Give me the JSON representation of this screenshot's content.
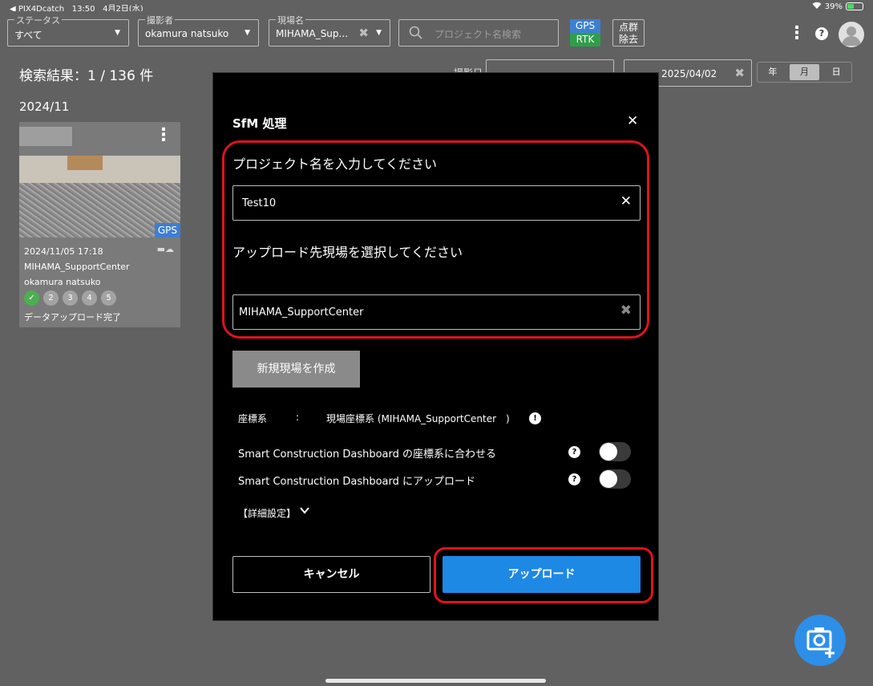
{
  "status_bar": {
    "back_app": "◀ PIX4Dcatch",
    "time": "13:50",
    "date": "4月2日(水)",
    "battery": "39%"
  },
  "filters": {
    "status": {
      "legend": "ステータス",
      "value": "すべて"
    },
    "photographer": {
      "legend": "撮影者",
      "value": "okamura natsuko"
    },
    "site": {
      "legend": "現場名",
      "value": "MIHAMA_Sup..."
    },
    "search_placeholder": "プロジェクト名検索",
    "gps_badge": {
      "top": "GPS",
      "bottom": "RTK"
    },
    "pointcloud_button": {
      "line1": "点群",
      "line2": "除去"
    }
  },
  "results": {
    "label": "検索結果：",
    "count": "1 / 136 件",
    "date_label": "撮影日",
    "date_to": "2025/04/02",
    "segment": [
      "年",
      "月",
      "日"
    ],
    "segment_selected": "月",
    "month_group": "2024/11"
  },
  "card": {
    "gps_tag": "GPS",
    "datetime": "2024/11/05  17:18",
    "site": "MIHAMA_SupportCenter",
    "photographer": "okamura natsuko",
    "steps": [
      "✓",
      "2",
      "3",
      "4",
      "5"
    ],
    "status": "データアップロード完了"
  },
  "modal": {
    "title": "SfM 処理",
    "project_label": "プロジェクト名を入力してください",
    "project_value": "Test10",
    "site_label": "アップロード先現場を選択してください",
    "site_value": "MIHAMA_SupportCenter",
    "new_site_button": "新規現場を作成",
    "coord_label": "座標系",
    "coord_colon": ":",
    "coord_value": "現場座標系 (MIHAMA_SupportCenter　)",
    "toggle1_label": "Smart Construction Dashboard の座標系に合わせる",
    "toggle2_label": "Smart Construction Dashboard にアップロード",
    "advanced_label": "【詳細設定】",
    "cancel_button": "キャンセル",
    "upload_button": "アップロード"
  },
  "colors": {
    "highlight": "#e0121a",
    "primary": "#1e88e5",
    "background": "#616161"
  }
}
